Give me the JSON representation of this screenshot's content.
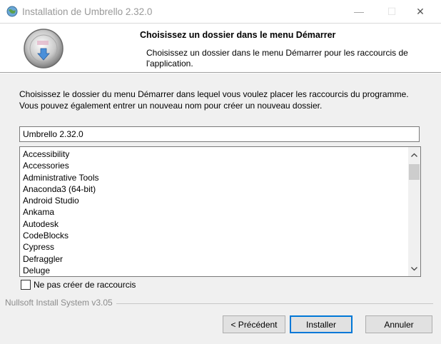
{
  "window": {
    "title": "Installation de Umbrello 2.32.0",
    "controls": {
      "minimize": "—",
      "maximize": "☐",
      "close": "✕"
    }
  },
  "header": {
    "title": "Choisissez un dossier dans le menu Démarrer",
    "subtitle": "Choisissez un dossier dans le menu Démarrer pour les raccourcis de l'application."
  },
  "description": "Choisissez le dossier du menu Démarrer dans lequel vous voulez placer les raccourcis du programme. Vous pouvez également entrer un nouveau nom pour créer un nouveau dossier.",
  "folder_input": {
    "value": "Umbrello 2.32.0"
  },
  "folder_list": {
    "items": [
      "Accessibility",
      "Accessories",
      "Administrative Tools",
      "Anaconda3 (64-bit)",
      "Android Studio",
      "Ankama",
      "Autodesk",
      "CodeBlocks",
      "Cypress",
      "Defraggler",
      "Deluge"
    ]
  },
  "no_shortcuts_checkbox": {
    "label": "Ne pas créer de raccourcis",
    "checked": false
  },
  "branding": "Nullsoft Install System v3.05",
  "buttons": {
    "back": "< Précédent",
    "install": "Installer",
    "cancel": "Annuler"
  },
  "colors": {
    "accent": "#0078d7",
    "window_bg": "#f0f0f0",
    "header_bg": "#ffffff"
  },
  "icons": {
    "app": "globe-icon",
    "header_logo": "installer-disc-icon"
  }
}
